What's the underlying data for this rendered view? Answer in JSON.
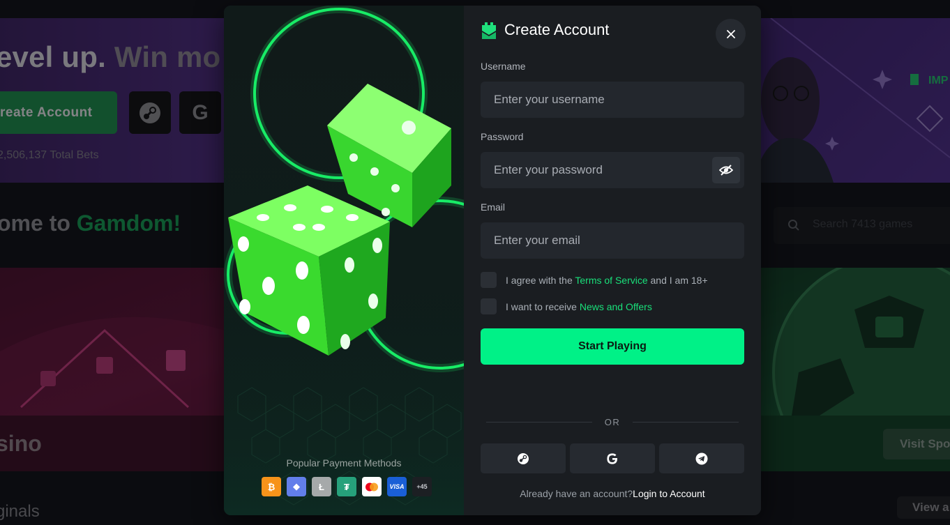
{
  "background": {
    "hero": {
      "headline_part1": "evel up.",
      "headline_part2": "Win mo",
      "cta_label": "reate Account",
      "stats": "2,506,137 Total Bets",
      "google_letter": "G"
    },
    "welcome": {
      "prefix": "ome to",
      "brand": "Gamdom!"
    },
    "search_placeholder": "Search 7413 games",
    "casino_label": "sino",
    "visit_label": "Visit Spo",
    "originals_label": "ginals",
    "view_all_label": "View a"
  },
  "modal": {
    "title": "Create Account",
    "username": {
      "label": "Username",
      "placeholder": "Enter your username"
    },
    "password": {
      "label": "Password",
      "placeholder": "Enter your password"
    },
    "email": {
      "label": "Email",
      "placeholder": "Enter your email"
    },
    "terms": {
      "prefix": "I agree with the",
      "link": "Terms of Service",
      "suffix": "and I am 18+"
    },
    "news": {
      "prefix": "I want to receive",
      "link": "News and Offers"
    },
    "submit_label": "Start Playing",
    "divider": "OR",
    "social_icons": [
      "steam-icon",
      "google-icon",
      "telegram-icon"
    ],
    "already_text": "Already have an account?",
    "login_link": "Login to Account",
    "payment": {
      "title": "Popular Payment Methods",
      "methods": [
        {
          "name": "bitcoin",
          "symbol": "₿",
          "color": "#f7931a"
        },
        {
          "name": "ethereum",
          "symbol": "◆",
          "color": "#627eea"
        },
        {
          "name": "litecoin",
          "symbol": "Ł",
          "color": "#a6a9aa"
        },
        {
          "name": "tether",
          "symbol": "₮",
          "color": "#26a17b"
        },
        {
          "name": "mastercard",
          "symbol": "",
          "color": "#ffffff"
        },
        {
          "name": "visa",
          "symbol": "VISA",
          "color": "#1a5fd6"
        }
      ],
      "more": "+45"
    }
  },
  "colors": {
    "accent": "#00f187",
    "link": "#19e07a",
    "modal_bg": "#1a1d21",
    "field_bg": "#23272d"
  }
}
